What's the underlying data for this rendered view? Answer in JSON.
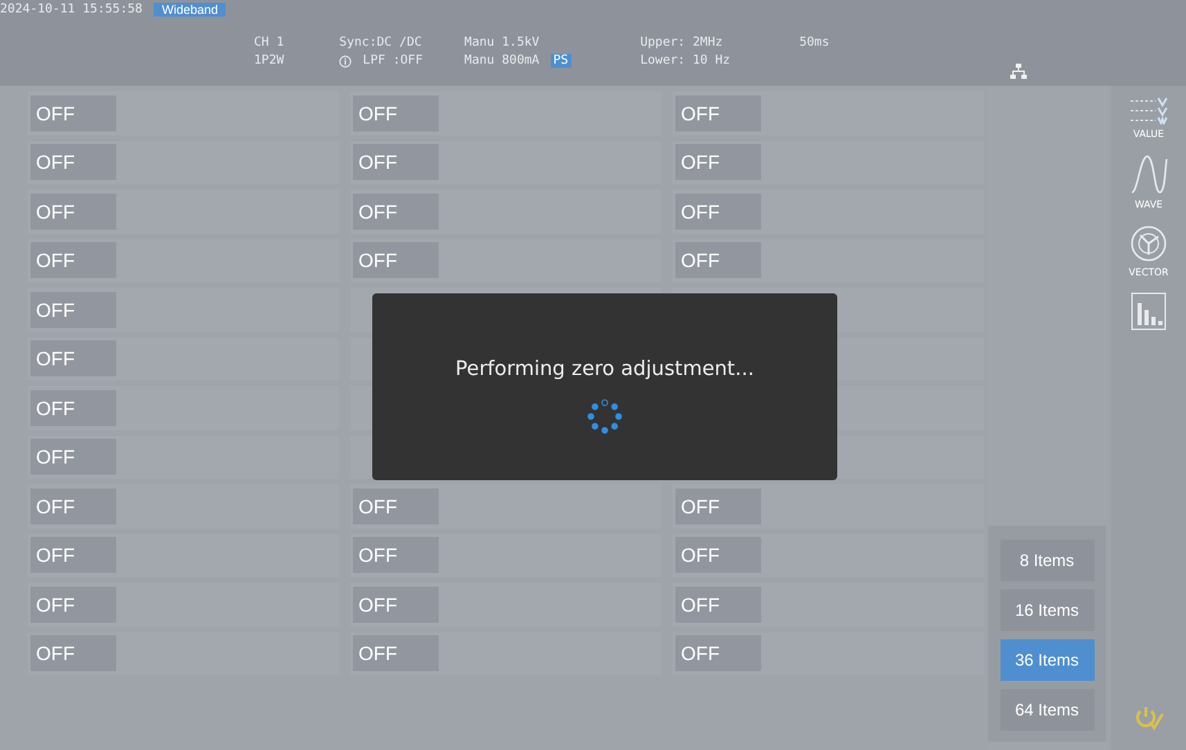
{
  "status_bar": {
    "datetime": "2024-10-11 15:55:58",
    "band": "Wideband",
    "channel": "CH 1",
    "wiring": "1P2W",
    "sync": "Sync:DC  /DC",
    "lpf": "LPF :OFF",
    "voltage_range": "Manu 1.5kV",
    "current_range": "Manu 800mA",
    "ps_badge": "PS",
    "upper": "Upper:  2MHz",
    "lower": "Lower: 10 Hz",
    "interval": "50ms"
  },
  "grid": {
    "columns": [
      {
        "cells": [
          "OFF",
          "OFF",
          "OFF",
          "OFF",
          "OFF",
          "OFF",
          "OFF",
          "OFF",
          "OFF",
          "OFF",
          "OFF",
          "OFF"
        ]
      },
      {
        "cells": [
          "OFF",
          "OFF",
          "OFF",
          "OFF",
          null,
          null,
          null,
          null,
          "OFF",
          "OFF",
          "OFF",
          "OFF"
        ]
      },
      {
        "cells": [
          "OFF",
          "OFF",
          "OFF",
          "OFF",
          null,
          null,
          null,
          null,
          "OFF",
          "OFF",
          "OFF",
          "OFF"
        ]
      }
    ]
  },
  "item_counts": [
    {
      "label": "8 Items",
      "selected": false
    },
    {
      "label": "16 Items",
      "selected": false
    },
    {
      "label": "36 Items",
      "selected": true
    },
    {
      "label": "64 Items",
      "selected": false
    }
  ],
  "sidebar": {
    "items": [
      {
        "kind": "value",
        "label": "VALUE"
      },
      {
        "kind": "wave",
        "label": "WAVE"
      },
      {
        "kind": "vector",
        "label": "VECTOR"
      },
      {
        "kind": "harmonic"
      }
    ]
  },
  "dialog": {
    "message": "Performing zero adjustment..."
  }
}
